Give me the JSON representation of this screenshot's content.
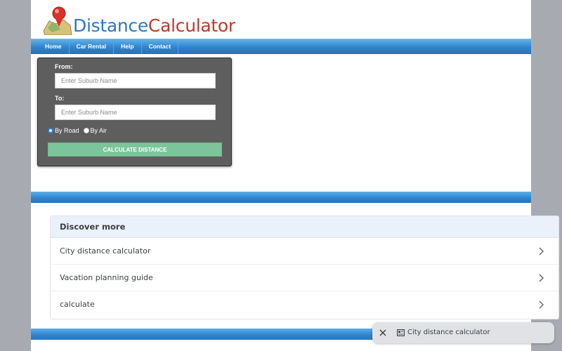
{
  "logo": {
    "part1": "Distance",
    "part2": "Calculator"
  },
  "nav": {
    "items": [
      "Home",
      "Car Rental",
      "Help",
      "Contact"
    ]
  },
  "form": {
    "from_label": "From:",
    "from_placeholder": "Enter Suburb Name",
    "to_label": "To:",
    "to_placeholder": "Enter Suburb Name",
    "by_road": "By Road",
    "by_air": "By Air",
    "selected_mode": "By Road",
    "calculate_label": "CALCULATE DISTANCE"
  },
  "discover": {
    "title": "Discover more",
    "items": [
      "City distance calculator",
      "Vacation planning guide",
      "calculate"
    ]
  },
  "toast": {
    "text": "City distance calculator"
  },
  "colors": {
    "nav_blue": "#2f83cc",
    "form_bg": "#5e5e5e",
    "button_green": "#7cc59a",
    "logo_blue": "#2f77c2",
    "logo_red": "#c0392b"
  }
}
